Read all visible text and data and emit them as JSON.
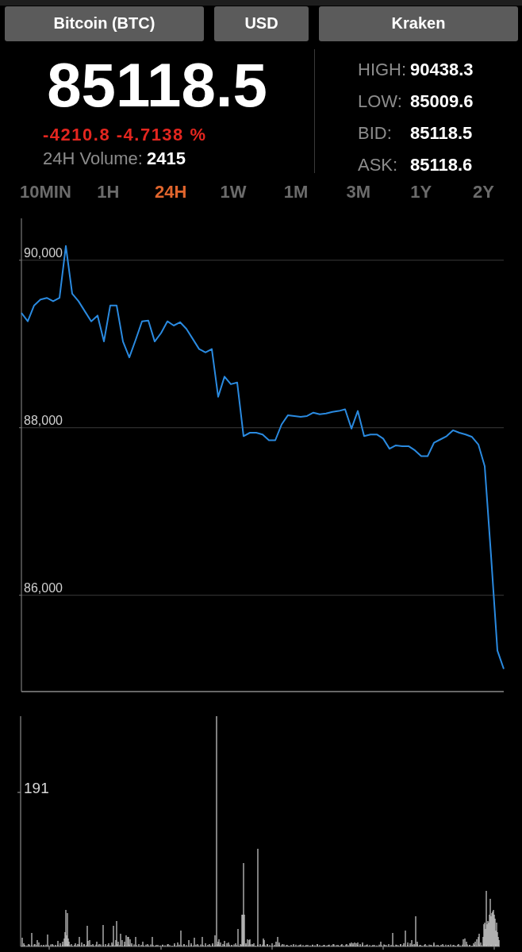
{
  "selectors": [
    {
      "label": "Bitcoin (BTC)"
    },
    {
      "label": "USD"
    },
    {
      "label": "Kraken"
    }
  ],
  "ticker": {
    "price": "85118.5",
    "change": "-4210.8 -4.7138 %",
    "volume_label": "24H Volume:",
    "volume": "2415"
  },
  "stats": [
    {
      "label": "HIGH:",
      "value": "90438.3"
    },
    {
      "label": "LOW:",
      "value": "85009.6"
    },
    {
      "label": "BID:",
      "value": "85118.5"
    },
    {
      "label": "ASK:",
      "value": "85118.6"
    }
  ],
  "timeframes": [
    {
      "label": "10MIN",
      "selected": false
    },
    {
      "label": "1H",
      "selected": false
    },
    {
      "label": "24H",
      "selected": true
    },
    {
      "label": "1W",
      "selected": false
    },
    {
      "label": "1M",
      "selected": false
    },
    {
      "label": "3M",
      "selected": false
    },
    {
      "label": "1Y",
      "selected": false
    },
    {
      "label": "2Y",
      "selected": false
    }
  ],
  "price_chart": {
    "chart_data": {
      "type": "line",
      "grid": true,
      "ylim": [
        84850,
        90500
      ],
      "yticks": [
        {
          "value": 90000,
          "label": "90,000"
        },
        {
          "value": 88000,
          "label": "88,000"
        },
        {
          "value": 86000,
          "label": "86,000"
        }
      ],
      "values": [
        89370,
        89270,
        89460,
        89530,
        89550,
        89510,
        89550,
        90170,
        89600,
        89510,
        89390,
        89270,
        89340,
        89030,
        89460,
        89460,
        89030,
        88840,
        89050,
        89270,
        89280,
        89030,
        89130,
        89270,
        89220,
        89260,
        89180,
        89060,
        88940,
        88900,
        88940,
        88370,
        88610,
        88520,
        88540,
        87900,
        87940,
        87940,
        87920,
        87850,
        87850,
        88040,
        88150,
        88140,
        88130,
        88140,
        88180,
        88160,
        88170,
        88190,
        88200,
        88220,
        87990,
        88200,
        87900,
        87920,
        87920,
        87870,
        87750,
        87790,
        87780,
        87780,
        87730,
        87660,
        87660,
        87820,
        87860,
        87900,
        87970,
        87940,
        87920,
        87890,
        87800,
        87540,
        86470,
        85340,
        85120
      ]
    }
  },
  "volume_chart": {
    "y_tick_label": "191"
  }
}
